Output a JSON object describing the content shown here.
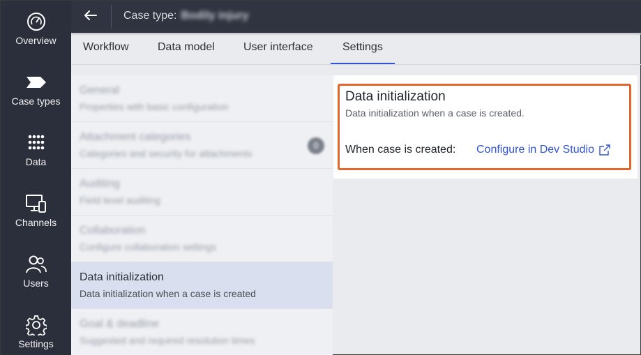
{
  "nav": {
    "items": [
      {
        "label": "Overview",
        "icon": "gauge-icon"
      },
      {
        "label": "Case types",
        "icon": "case-type-icon"
      },
      {
        "label": "Data",
        "icon": "grid-dots-icon"
      },
      {
        "label": "Channels",
        "icon": "channels-icon"
      },
      {
        "label": "Users",
        "icon": "users-icon"
      },
      {
        "label": "Settings",
        "icon": "gear-icon"
      }
    ]
  },
  "header": {
    "title_prefix": "Case type:",
    "case_name": "Bodily injury"
  },
  "tabs": [
    {
      "label": "Workflow"
    },
    {
      "label": "Data model"
    },
    {
      "label": "User interface"
    },
    {
      "label": "Settings",
      "active": true
    }
  ],
  "settings": {
    "items": [
      {
        "title": "General",
        "desc": "Properties with basic configuration"
      },
      {
        "title": "Attachment categories",
        "desc": "Categories and security for attachments",
        "badge": "0"
      },
      {
        "title": "Auditing",
        "desc": "Field level auditing"
      },
      {
        "title": "Collaboration",
        "desc": "Configure collaboration settings"
      },
      {
        "title": "Data initialization",
        "desc": "Data initialization when a case is created",
        "selected": true
      },
      {
        "title": "Goal & deadline",
        "desc": "Suggested and required resolution times"
      }
    ]
  },
  "panel": {
    "title": "Data initialization",
    "subtitle": "Data initialization when a case is created.",
    "field_label": "When case is created:",
    "link_label": "Configure in Dev Studio"
  },
  "colors": {
    "accent": "#2f54d4",
    "highlight": "#e3672d",
    "nav_bg": "#2b2f3b"
  }
}
